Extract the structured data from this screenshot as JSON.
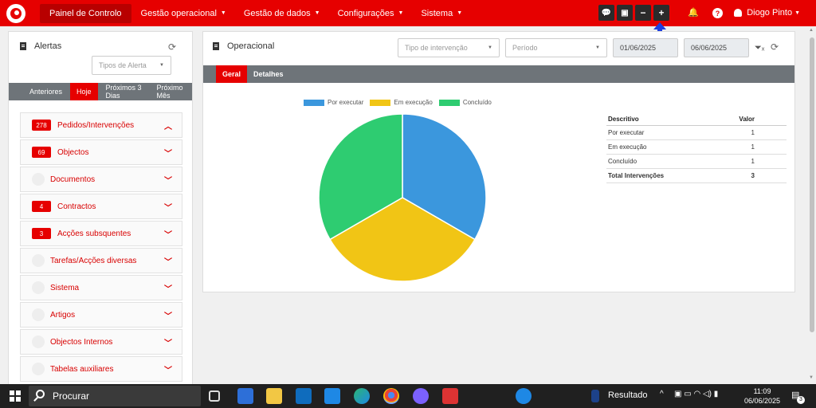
{
  "nav": {
    "items": [
      {
        "label": "Painel de Controlo",
        "active": true,
        "dropdown": false
      },
      {
        "label": "Gestão operacional",
        "active": false,
        "dropdown": true
      },
      {
        "label": "Gestão de dados",
        "active": false,
        "dropdown": true
      },
      {
        "label": "Configurações",
        "active": false,
        "dropdown": true
      },
      {
        "label": "Sistema",
        "active": false,
        "dropdown": true
      }
    ],
    "tools": {
      "chat_icon": "chat-icon",
      "card_icon": "id-card-icon",
      "zoom_out": "−",
      "zoom_in": "+"
    },
    "user_name": "Diogo Pinto"
  },
  "alerts": {
    "title": "Alertas",
    "type_select_placeholder": "Tipos de Alerta",
    "tabs": [
      "Anteriores",
      "Hoje",
      "Próximos 3 Dias",
      "Próximo Mês"
    ],
    "active_tab": "Hoje",
    "items": [
      {
        "count": "278",
        "label": "Pedidos/Intervenções",
        "expanded": true
      },
      {
        "count": "69",
        "label": "Objectos",
        "expanded": false
      },
      {
        "count": "",
        "label": "Documentos",
        "expanded": false
      },
      {
        "count": "4",
        "label": "Contractos",
        "expanded": false
      },
      {
        "count": "3",
        "label": "Acções subsquentes",
        "expanded": false
      },
      {
        "count": "",
        "label": "Tarefas/Acções diversas",
        "expanded": false
      },
      {
        "count": "",
        "label": "Sistema",
        "expanded": false
      },
      {
        "count": "",
        "label": "Artigos",
        "expanded": false
      },
      {
        "count": "",
        "label": "Objectos Internos",
        "expanded": false
      },
      {
        "count": "",
        "label": "Tabelas auxiliares",
        "expanded": false
      }
    ]
  },
  "operational": {
    "title": "Operacional",
    "intervention_type_placeholder": "Tipo de intervenção",
    "period_placeholder": "Período",
    "date_from": "01/06/2025",
    "date_to": "06/06/2025",
    "tabs": [
      "Geral",
      "Detalhes"
    ],
    "active_tab": "Geral",
    "table": {
      "headers": [
        "Descritivo",
        "Valor"
      ],
      "rows": [
        {
          "label": "Por executar",
          "value": "1"
        },
        {
          "label": "Em execução",
          "value": "1"
        },
        {
          "label": "Concluído",
          "value": "1"
        }
      ],
      "total": {
        "label": "Total Intervenções",
        "value": "3"
      }
    }
  },
  "chart_data": {
    "type": "pie",
    "categories": [
      "Por executar",
      "Em execução",
      "Concluído"
    ],
    "values": [
      1,
      1,
      1
    ],
    "colors": [
      "#3b97dd",
      "#f1c515",
      "#2ecc71"
    ],
    "legend": "top"
  },
  "taskbar": {
    "search_placeholder": "Procurar",
    "weather_label": "Resultado",
    "time": "11:09",
    "date": "06/06/2025",
    "notification_count": "3"
  }
}
